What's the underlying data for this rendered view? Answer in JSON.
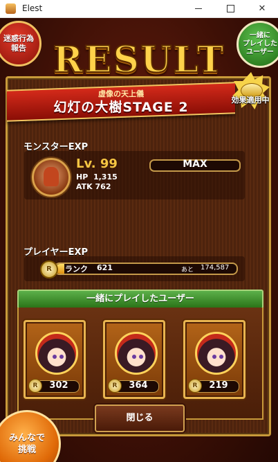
{
  "window": {
    "title": "Elest"
  },
  "buttons": {
    "meiwaku": "迷惑行為\n報告",
    "played_with": "一緒に\nプレイした\nユーザー",
    "close": "閉じる",
    "minna": "みんなで\n挑戦"
  },
  "result_title": "RESULT",
  "stage": {
    "subtitle": "虚像の天上儀",
    "name": "幻灯の大樹STAGE 2"
  },
  "effect_badge": {
    "label": "効果適用中"
  },
  "monster": {
    "section_label": "モンスターEXP",
    "level_label": "Lv.",
    "level": "99",
    "hp_label": "HP",
    "hp": "1,315",
    "atk_label": "ATK",
    "atk": "762",
    "exp_status": "MAX"
  },
  "player": {
    "section_label": "プレイヤーEXP",
    "rank_label": "ランク",
    "rank": "621",
    "next_label": "あと",
    "next_value": "174,587",
    "progress_fraction": 0.05
  },
  "co_players": {
    "header": "一緒にプレイしたユーザー",
    "users": [
      {
        "rank": "302"
      },
      {
        "rank": "364"
      },
      {
        "rank": "219"
      }
    ]
  },
  "rank_icon_letter": "R",
  "colors": {
    "gold": "#f5c542",
    "banner_red": "#c42a1a",
    "green": "#3a8c28"
  }
}
